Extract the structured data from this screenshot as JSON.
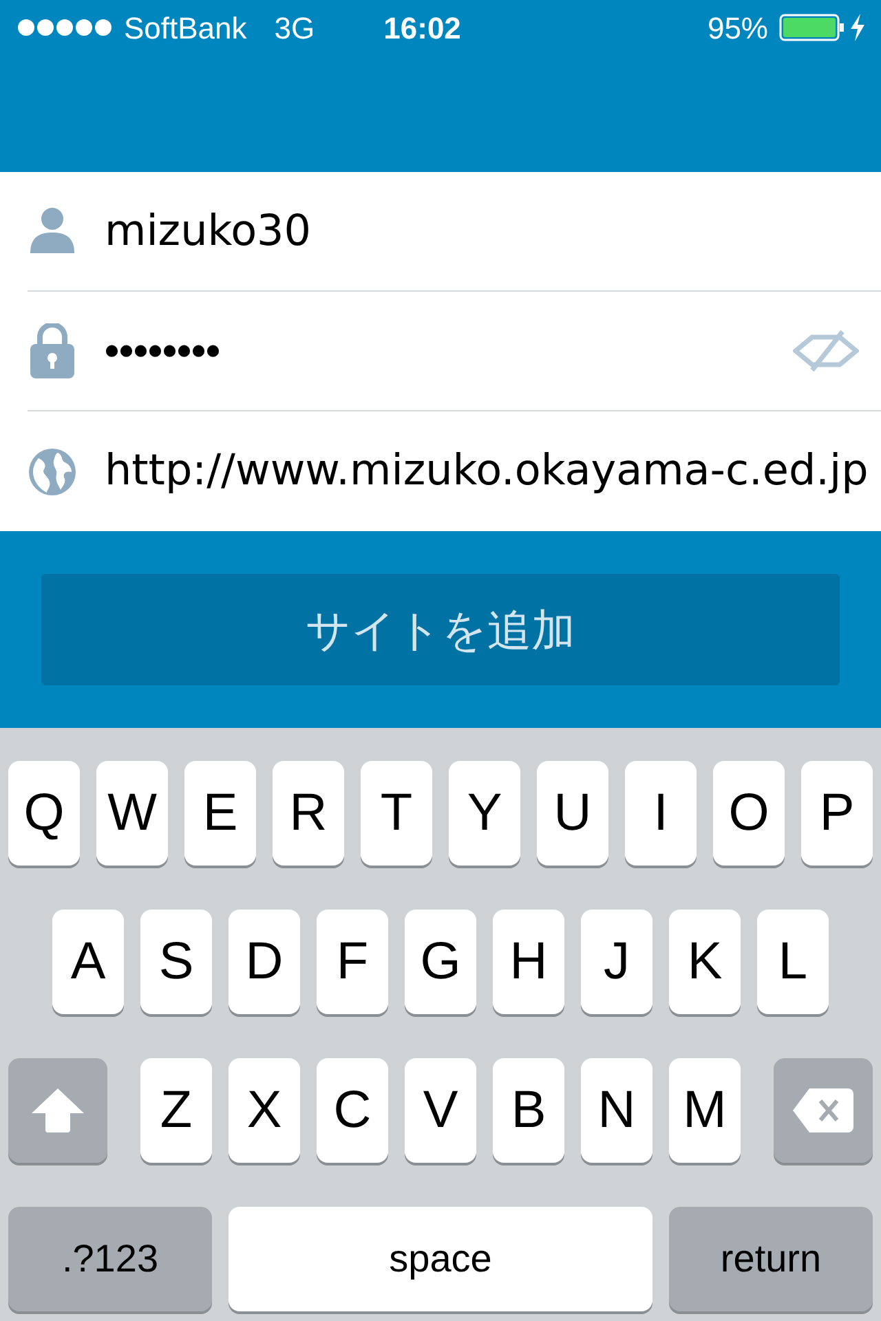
{
  "status_bar": {
    "carrier": "SoftBank",
    "network": "3G",
    "time": "16:02",
    "battery": "95%",
    "charging": true
  },
  "fields": [
    {
      "kind": "user",
      "value": "mizuko30"
    },
    {
      "kind": "password",
      "value": "••••••••"
    },
    {
      "kind": "url",
      "value": "http://www.mizuko.okayama-c.ed.jp"
    }
  ],
  "submit_button": "サイトを追加",
  "keyboard": {
    "keys": [
      {
        "kind": "letter",
        "label": "Q"
      },
      {
        "kind": "letter",
        "label": "W"
      },
      {
        "kind": "letter",
        "label": "E"
      },
      {
        "kind": "letter",
        "label": "R"
      },
      {
        "kind": "letter",
        "label": "T"
      },
      {
        "kind": "letter",
        "label": "Y"
      },
      {
        "kind": "letter",
        "label": "U"
      },
      {
        "kind": "letter",
        "label": "I"
      },
      {
        "kind": "letter",
        "label": "O"
      },
      {
        "kind": "letter",
        "label": "P"
      },
      {
        "kind": "break"
      },
      {
        "kind": "letter",
        "label": "A"
      },
      {
        "kind": "letter",
        "label": "S"
      },
      {
        "kind": "letter",
        "label": "D"
      },
      {
        "kind": "letter",
        "label": "F"
      },
      {
        "kind": "letter",
        "label": "G"
      },
      {
        "kind": "letter",
        "label": "H"
      },
      {
        "kind": "letter",
        "label": "J"
      },
      {
        "kind": "letter",
        "label": "K"
      },
      {
        "kind": "letter",
        "label": "L"
      },
      {
        "kind": "break"
      },
      {
        "kind": "shift"
      },
      {
        "kind": "letter",
        "label": "Z"
      },
      {
        "kind": "letter",
        "label": "X"
      },
      {
        "kind": "letter",
        "label": "C"
      },
      {
        "kind": "letter",
        "label": "V"
      },
      {
        "kind": "letter",
        "label": "B"
      },
      {
        "kind": "letter",
        "label": "N"
      },
      {
        "kind": "letter",
        "label": "M"
      },
      {
        "kind": "delete"
      },
      {
        "kind": "break"
      },
      {
        "kind": "mode",
        "label": ".?123"
      },
      {
        "kind": "space",
        "label": "space"
      },
      {
        "kind": "return",
        "label": "return"
      }
    ]
  }
}
